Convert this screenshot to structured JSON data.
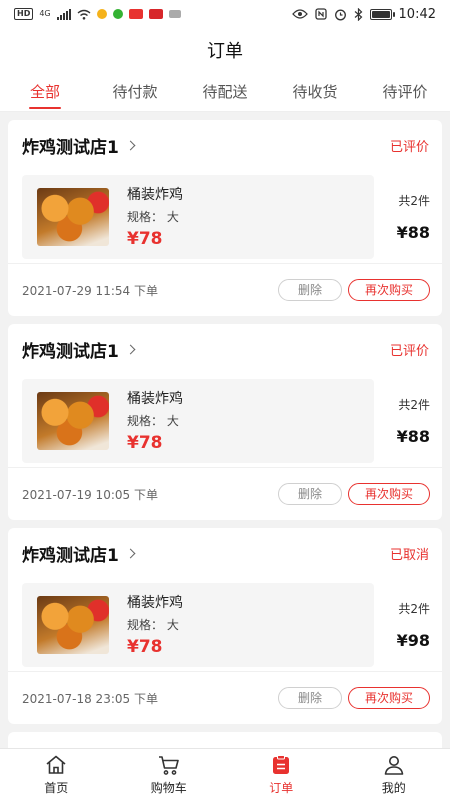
{
  "status_bar": {
    "time": "10:42",
    "network_type": "4G"
  },
  "header": {
    "title": "订单"
  },
  "tabs": [
    {
      "label": "全部",
      "active": true
    },
    {
      "label": "待付款",
      "active": false
    },
    {
      "label": "待配送",
      "active": false
    },
    {
      "label": "待收货",
      "active": false
    },
    {
      "label": "待评价",
      "active": false
    }
  ],
  "orders": [
    {
      "shop": "炸鸡测试店1",
      "status": "已评价",
      "item_name": "桶装炸鸡",
      "item_spec": "规格：  大",
      "item_price": "¥78",
      "count": "共2件",
      "total": "¥88",
      "date": "2021-07-29 11:54 下单",
      "delete_label": "删除",
      "rebuy_label": "再次购买"
    },
    {
      "shop": "炸鸡测试店1",
      "status": "已评价",
      "item_name": "桶装炸鸡",
      "item_spec": "规格：  大",
      "item_price": "¥78",
      "count": "共2件",
      "total": "¥88",
      "date": "2021-07-19 10:05 下单",
      "delete_label": "删除",
      "rebuy_label": "再次购买"
    },
    {
      "shop": "炸鸡测试店1",
      "status": "已取消",
      "item_name": "桶装炸鸡",
      "item_spec": "规格：  大",
      "item_price": "¥78",
      "count": "共2件",
      "total": "¥98",
      "date": "2021-07-18 23:05 下单",
      "delete_label": "删除",
      "rebuy_label": "再次购买"
    }
  ],
  "tabbar": [
    {
      "label": "首页",
      "icon": "home-icon",
      "active": false
    },
    {
      "label": "购物车",
      "icon": "cart-icon",
      "active": false
    },
    {
      "label": "订单",
      "icon": "order-icon",
      "active": true
    },
    {
      "label": "我的",
      "icon": "profile-icon",
      "active": false
    }
  ],
  "colors": {
    "accent": "#e8322f",
    "background": "#f2f2f2"
  }
}
